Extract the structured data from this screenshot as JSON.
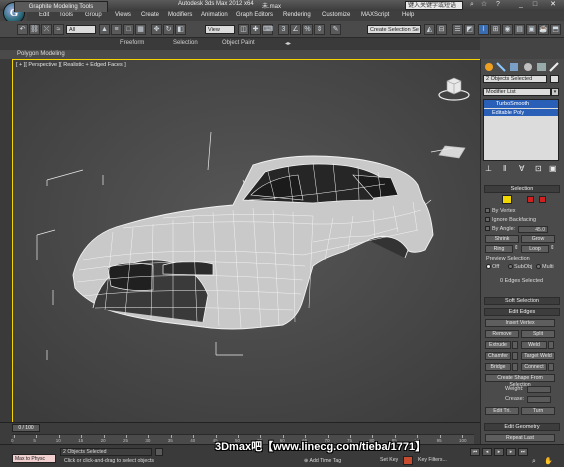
{
  "window": {
    "title_app": "Autodesk 3ds Max  2012 x64",
    "title_file": "未.max",
    "search_placeholder": "键入关键字或短语",
    "logo": "G"
  },
  "menu": [
    "Edit",
    "Tools",
    "Group",
    "Views",
    "Create",
    "Modifiers",
    "Animation",
    "Graph Editors",
    "Rendering",
    "Customize",
    "MAXScript",
    "Help"
  ],
  "toolbar": {
    "filter_combo": "All",
    "view_combo": "View",
    "selection_set_combo": "Create Selection Se",
    "snap_label": "3",
    "percent_label": "%"
  },
  "ribbon": {
    "tabs": [
      "Graphite Modeling Tools",
      "Freeform",
      "Selection",
      "Object Paint"
    ],
    "subtitle": "Polygon Modeling"
  },
  "viewport": {
    "label": "[ + ][ Perspective ][ Realistic + Edged Faces ]"
  },
  "command_panel": {
    "object_name": "2 Objects Selected",
    "modifier_list": "Modifier List",
    "stack": [
      "TurboSmooth",
      "Editable Poly"
    ],
    "rollouts": {
      "selection": "Selection",
      "soft_selection": "Soft Selection",
      "edit_edges": "Edit Edges",
      "edit_geometry": "Edit Geometry"
    },
    "selection": {
      "by_vertex": "By Vertex",
      "ignore_backfacing": "Ignore Backfacing",
      "by_angle": "By Angle:",
      "by_angle_value": "45.0",
      "shrink": "Shrink",
      "grow": "Grow",
      "ring": "Ring",
      "loop": "Loop",
      "preview_selection": "Preview Selection",
      "off": "Off",
      "subobj": "SubObj",
      "multi": "Multi",
      "status": "0 Edges Selected"
    },
    "edit_edges": {
      "insert_vertex": "Insert Vertex",
      "remove": "Remove",
      "split": "Split",
      "extrude": "Extrude",
      "weld": "Weld",
      "chamfer": "Chamfer",
      "target_weld": "Target Weld",
      "bridge": "Bridge",
      "connect": "Connect",
      "create_shape": "Create Shape From Selection",
      "weight": "Weight:",
      "crease": "Crease:",
      "edit_tri": "Edit Tri.",
      "turn": "Turn",
      "repeat_last": "Repeat Last"
    }
  },
  "timeline": {
    "frame_label": "0 / 100",
    "ticks": [
      "0",
      "5",
      "10",
      "15",
      "20",
      "25",
      "30",
      "35",
      "40",
      "45",
      "50",
      "55",
      "60",
      "65",
      "70",
      "75",
      "80",
      "85",
      "90",
      "95",
      "100"
    ]
  },
  "status": {
    "script_field": "Max to Physc",
    "objects_selected": "2 Objects Selected",
    "prompt": "Click or click-and-drag to select objects",
    "add_time_tag": "Add Time Tag",
    "set_key": "Set Key",
    "key_filters": "Key Filters..."
  },
  "watermark": "3Dmax吧【www.linecg.com/tieba/1771】",
  "colors": {
    "viewport_border": "#f5d400",
    "selection_highlight": "#2a5fb8",
    "wire": "#f2f2f2"
  }
}
